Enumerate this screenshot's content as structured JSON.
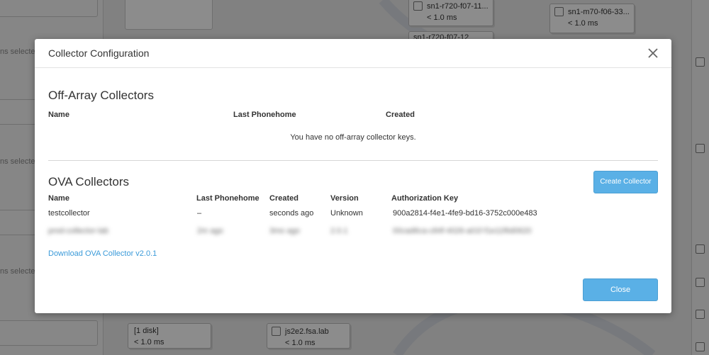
{
  "background": {
    "hint_text": "ns selecte",
    "nodes": [
      {
        "name": "sn1-r720-f07-11...",
        "latency": "< 1.0 ms"
      },
      {
        "name": "sn1-m70-f06-33...",
        "latency": "< 1.0 ms"
      },
      {
        "name": "sn1-r720-f07-12",
        "latency": ""
      },
      {
        "name": "[1 disk]",
        "latency": "< 1.0 ms"
      },
      {
        "name": "js2e2.fsa.lab",
        "latency": "< 1.0 ms"
      }
    ]
  },
  "modal": {
    "title": "Collector Configuration",
    "off_array": {
      "title": "Off-Array Collectors",
      "columns": [
        "Name",
        "Last Phonehome",
        "Created"
      ],
      "empty_message": "You have no off-array collector keys."
    },
    "ova": {
      "title": "OVA Collectors",
      "create_button": "Create Collector",
      "columns": [
        "Name",
        "Last Phonehome",
        "Created",
        "Version",
        "Authorization Key"
      ],
      "rows": [
        {
          "name": "testcollector",
          "last_phonehome": "–",
          "created": "seconds ago",
          "version": "Unknown",
          "key": "900a2814-f4e1-4fe9-bd16-3752c000e483"
        },
        {
          "name": "prod-collector-lab",
          "last_phonehome": "2m ago",
          "created": "3mo ago",
          "version": "2.0.1",
          "key": "00cad6ca-c84f-4026-a01f-f1e11f6d0620"
        }
      ],
      "download_link": "Download OVA Collector v2.0.1"
    },
    "close_button": "Close"
  }
}
